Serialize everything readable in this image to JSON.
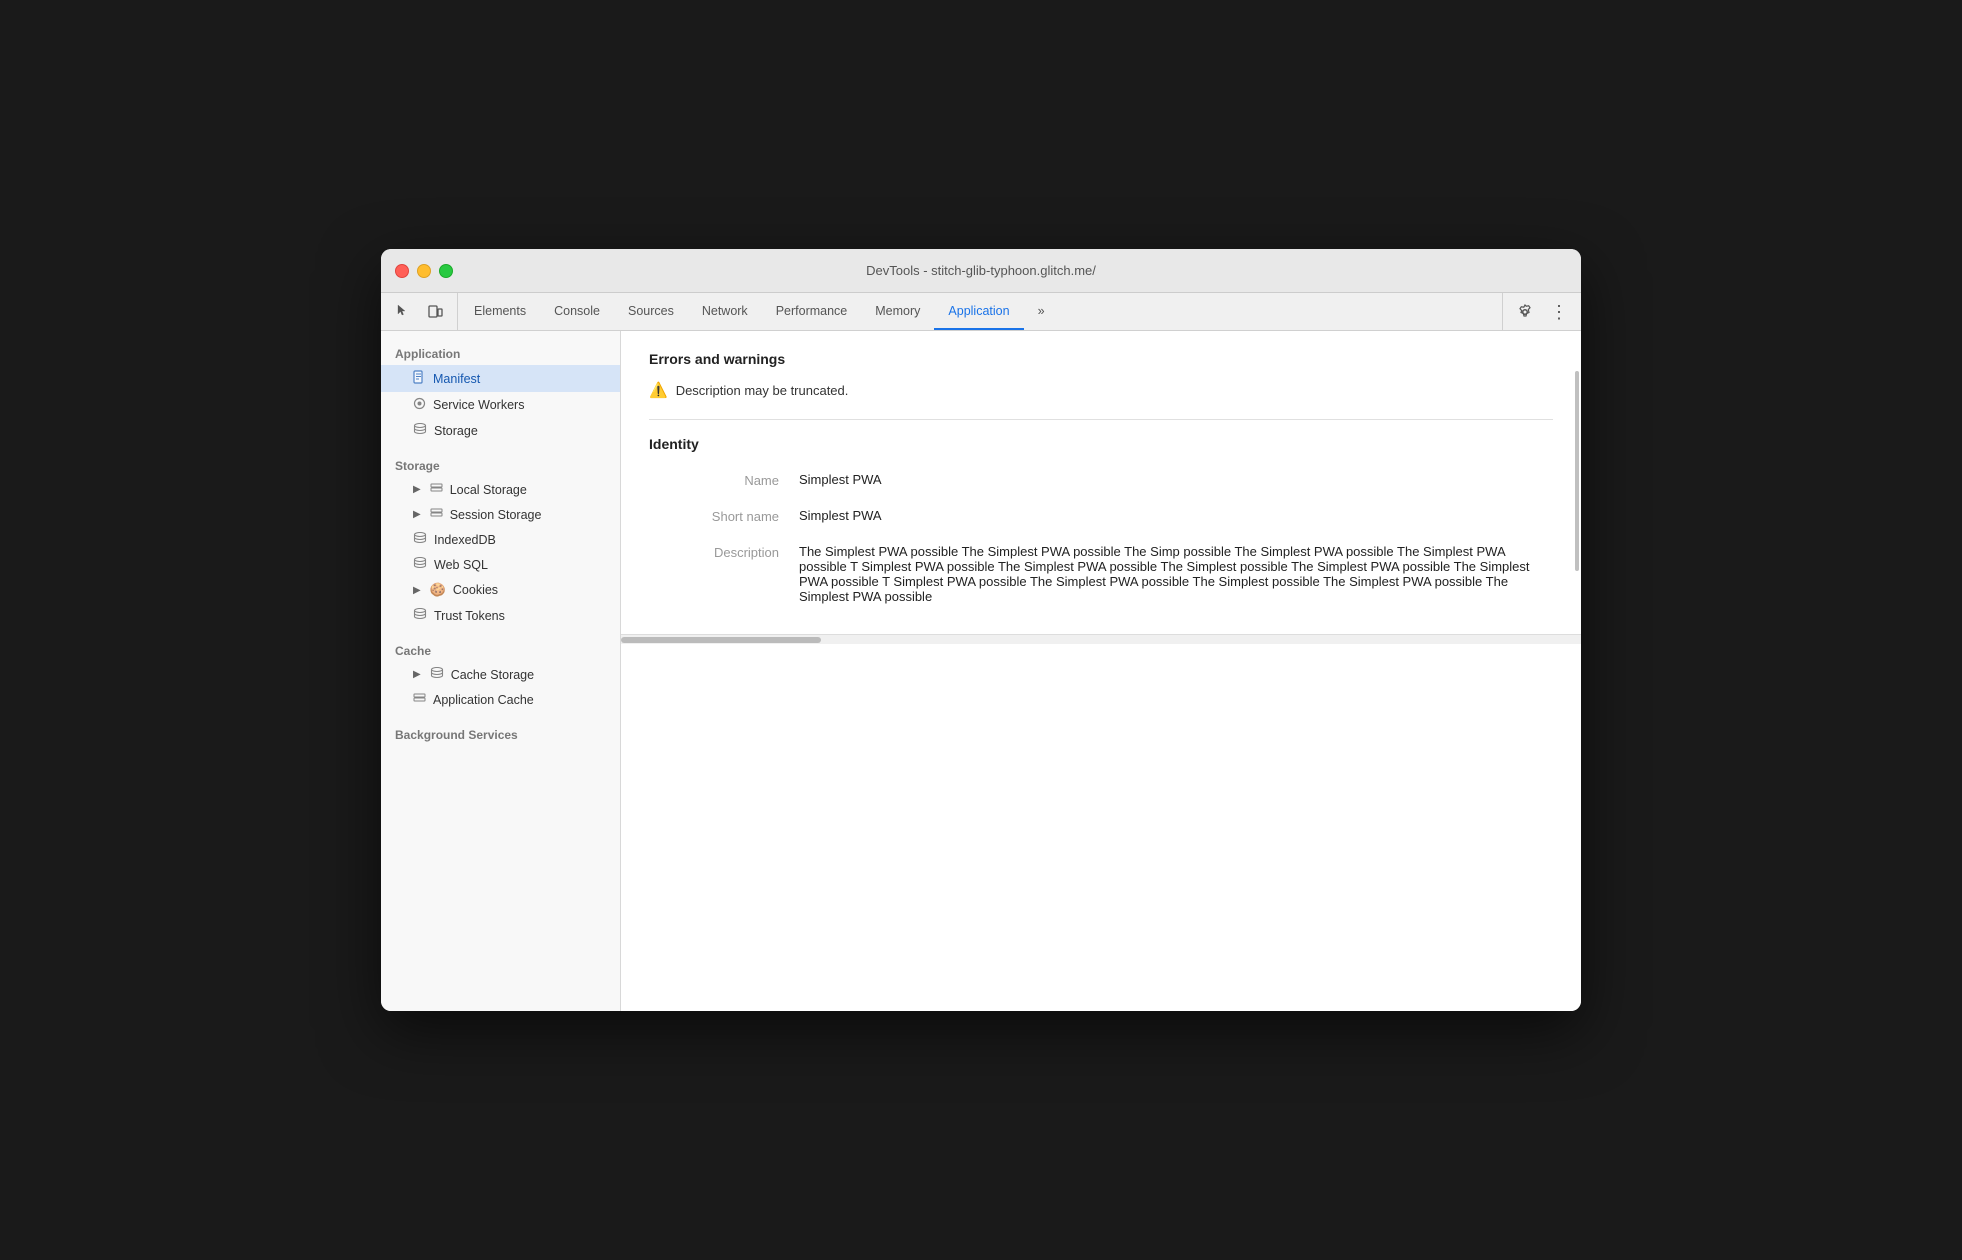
{
  "window": {
    "title": "DevTools - stitch-glib-typhoon.glitch.me/"
  },
  "toolbar": {
    "icons": [
      {
        "name": "cursor-icon",
        "symbol": "↖"
      },
      {
        "name": "device-icon",
        "symbol": "⬜"
      }
    ],
    "tabs": [
      {
        "id": "elements",
        "label": "Elements",
        "active": false
      },
      {
        "id": "console",
        "label": "Console",
        "active": false
      },
      {
        "id": "sources",
        "label": "Sources",
        "active": false
      },
      {
        "id": "network",
        "label": "Network",
        "active": false
      },
      {
        "id": "performance",
        "label": "Performance",
        "active": false
      },
      {
        "id": "memory",
        "label": "Memory",
        "active": false
      },
      {
        "id": "application",
        "label": "Application",
        "active": true
      }
    ],
    "overflow_label": "»",
    "settings_icon": "⚙",
    "more_icon": "⋮"
  },
  "sidebar": {
    "sections": [
      {
        "label": "Application",
        "items": [
          {
            "id": "manifest",
            "label": "Manifest",
            "icon": "📄",
            "active": true,
            "indent": 1
          },
          {
            "id": "service-workers",
            "label": "Service Workers",
            "icon": "⚙",
            "active": false,
            "indent": 1
          },
          {
            "id": "storage",
            "label": "Storage",
            "icon": "🗄",
            "active": false,
            "indent": 1
          }
        ]
      },
      {
        "label": "Storage",
        "items": [
          {
            "id": "local-storage",
            "label": "Local Storage",
            "icon": "▦",
            "active": false,
            "indent": 1,
            "expandable": true
          },
          {
            "id": "session-storage",
            "label": "Session Storage",
            "icon": "▦",
            "active": false,
            "indent": 1,
            "expandable": true
          },
          {
            "id": "indexeddb",
            "label": "IndexedDB",
            "icon": "🗄",
            "active": false,
            "indent": 1
          },
          {
            "id": "web-sql",
            "label": "Web SQL",
            "icon": "🗄",
            "active": false,
            "indent": 1
          },
          {
            "id": "cookies",
            "label": "Cookies",
            "icon": "🍪",
            "active": false,
            "indent": 1,
            "expandable": true
          },
          {
            "id": "trust-tokens",
            "label": "Trust Tokens",
            "icon": "🗄",
            "active": false,
            "indent": 1
          }
        ]
      },
      {
        "label": "Cache",
        "items": [
          {
            "id": "cache-storage",
            "label": "Cache Storage",
            "icon": "🗄",
            "active": false,
            "indent": 1,
            "expandable": true
          },
          {
            "id": "application-cache",
            "label": "Application Cache",
            "icon": "▦",
            "active": false,
            "indent": 1
          }
        ]
      },
      {
        "label": "Background Services",
        "items": []
      }
    ]
  },
  "content": {
    "errors_section": {
      "title": "Errors and warnings",
      "warning_text": "Description may be truncated."
    },
    "identity_section": {
      "title": "Identity",
      "fields": [
        {
          "label": "Name",
          "value": "Simplest PWA"
        },
        {
          "label": "Short name",
          "value": "Simplest PWA"
        },
        {
          "label": "Description",
          "value": "The Simplest PWA possible The Simplest PWA possible The Simp possible The Simplest PWA possible The Simplest PWA possible T Simplest PWA possible The Simplest PWA possible The Simplest possible The Simplest PWA possible The Simplest PWA possible T Simplest PWA possible The Simplest PWA possible The Simplest possible The Simplest PWA possible The Simplest PWA possible"
        }
      ]
    }
  }
}
